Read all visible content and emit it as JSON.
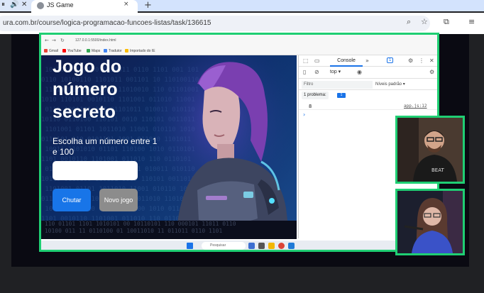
{
  "browser": {
    "tab_title": "JS Game",
    "url": "ura.com.br/course/logica-programacao-funcoes-listas/task/136615",
    "new_tab_symbol": "+",
    "close_tab_symbol": "×"
  },
  "recorded": {
    "inner_url": "127.0.0.1:5500/index.html",
    "bookmarks": [
      "Gmail",
      "YouTube",
      "Maps",
      "Tradutor",
      "Importado do IE"
    ],
    "bookmark_colors": [
      "#ea4335",
      "#ff0000",
      "#34a853",
      "#4285f4",
      "#fbbc05"
    ]
  },
  "game": {
    "heading": "Jogo do número secreto",
    "prompt": "Escolha um número entre 1 e 100",
    "input_value": "",
    "guess_button": "Chutar",
    "new_game_button": "Novo jogo"
  },
  "devtools": {
    "console_tab": "Console",
    "more_tabs": "»",
    "messages_badge": "1",
    "context": "top",
    "filter_placeholder": "Filtro",
    "levels": "Níveis padrão",
    "issues_label": "1 problema:",
    "issues_badge": "1",
    "log_value": "8",
    "log_source": "app.js:12",
    "prompt_symbol": "›"
  },
  "taskbar": {
    "search_placeholder": "Pesquisar"
  },
  "icons": [
    "pause-icon",
    "volume-icon",
    "close-icon",
    "globe-icon",
    "zoom-icon",
    "star-icon",
    "extensions-icon",
    "media-icon",
    "windows-start-icon"
  ],
  "colors": {
    "accent_border": "#1fcf73",
    "guess_button": "#1875e8",
    "new_game_button": "#8c8c8c",
    "devtools_link": "#1a73e8"
  }
}
